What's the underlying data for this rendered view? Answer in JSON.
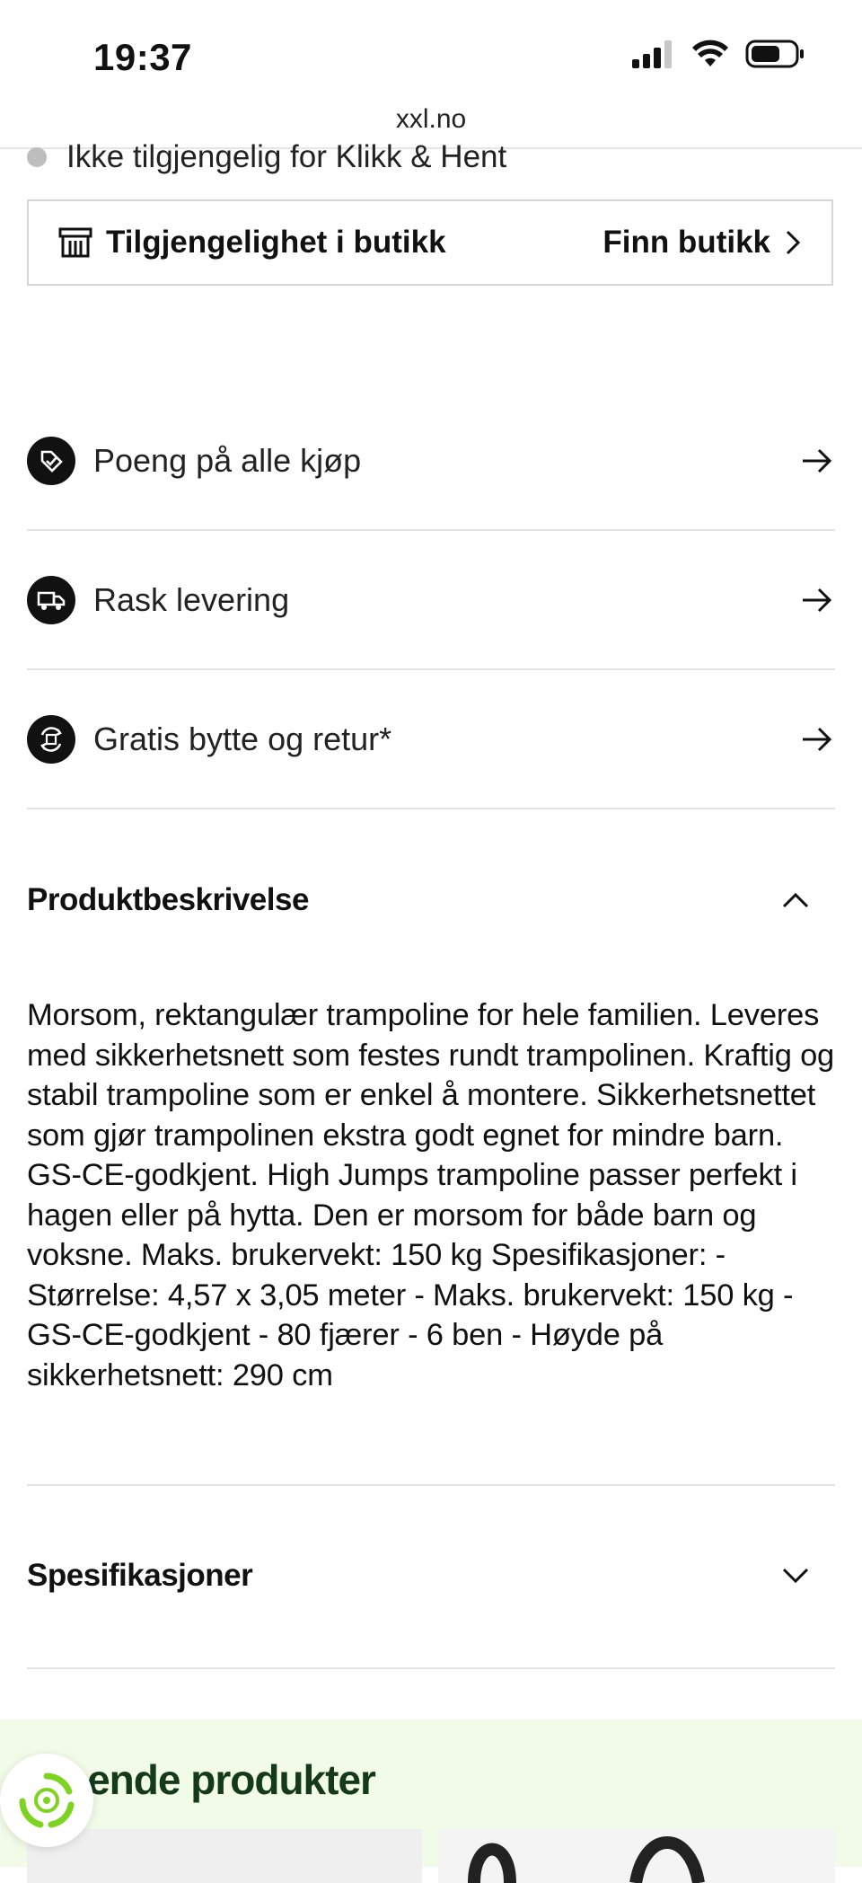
{
  "status": {
    "time": "19:37"
  },
  "browser": {
    "url": "xxl.no"
  },
  "pickup": {
    "text": "Ikke tilgjengelig for Klikk & Hent"
  },
  "store": {
    "label": "Tilgjengelighet i butikk",
    "link": "Finn butikk"
  },
  "perks": [
    {
      "label": "Poeng på alle kjøp",
      "icon": "tag-check-icon"
    },
    {
      "label": "Rask levering",
      "icon": "truck-icon"
    },
    {
      "label": "Gratis bytte og retur*",
      "icon": "exchange-icon"
    }
  ],
  "description": {
    "title": "Produktbeskrivelse",
    "text": "Morsom, rektangulær trampoline for hele familien. Leveres med sikkerhetsnett som festes rundt trampolinen. Kraftig og stabil trampoline som er enkel å montere. Sikkerhetsnettet som gjør trampolinen ekstra godt egnet for mindre barn. GS-CE-godkjent. High Jumps trampoline passer perfekt i hagen eller på hytta. Den er morsom for både barn og voksne. Maks. brukervekt: 150 kg Spesifikasjoner: - Størrelse: 4,57 x 3,05 meter - Maks. brukervekt: 150 kg - GS-CE-godkjent - 80 fjærer - 6 ben - Høyde på sikkerhetsnett: 290 cm"
  },
  "specs": {
    "title": "Spesifikasjoner"
  },
  "related": {
    "title": "nende produkter"
  },
  "colors": {
    "accent_bg": "#f1fbe7",
    "related_title": "#143a1a",
    "fab_green": "#7ed321"
  }
}
